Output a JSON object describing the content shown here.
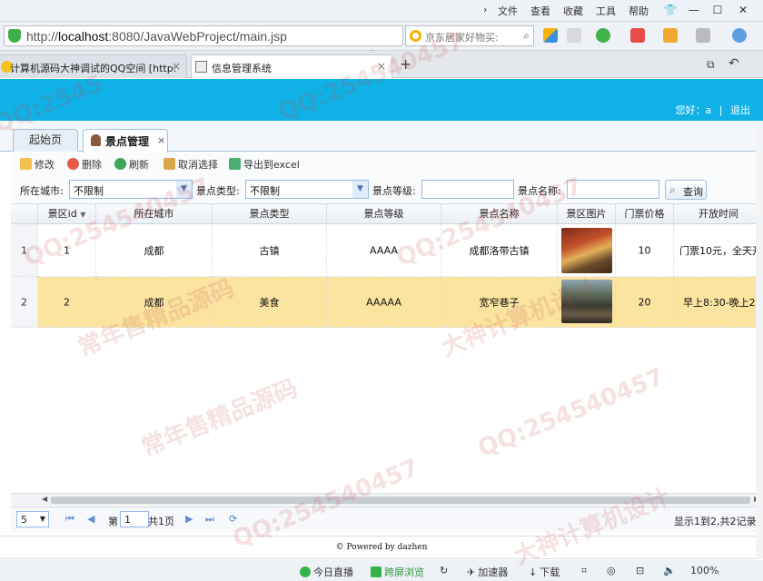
{
  "browser": {
    "menu": [
      "文件",
      "查看",
      "收藏",
      "工具",
      "帮助"
    ],
    "url_prefix": "http://",
    "url_host": "localhost",
    "url_rest": ":8080/JavaWebProject/main.jsp",
    "search_text": "京东居家好物买:",
    "tabs": [
      {
        "label": "计算机源码大神调试的QQ空间 [http:",
        "active": false
      },
      {
        "label": "信息管理系统",
        "active": true
      }
    ],
    "new_tab": "+"
  },
  "app": {
    "user_text": "您好：a",
    "logout_text": "退出",
    "tabs": [
      {
        "label": "起始页",
        "active": false
      },
      {
        "label": "景点管理",
        "active": true
      }
    ],
    "tab_close": "×",
    "toolbar": {
      "edit": "修改",
      "delete": "删除",
      "refresh": "刷新",
      "cancel_select": "取消选择",
      "export": "导出到excel"
    },
    "filters": {
      "city_label": "所在城市:",
      "city_value": "不限制",
      "type_label": "景点类型:",
      "type_value": "不限制",
      "level_label": "景点等级:",
      "level_value": "",
      "name_label": "景点名称:",
      "name_value": "",
      "query_button": "查询"
    },
    "grid": {
      "columns": [
        "景区id",
        "所在城市",
        "景点类型",
        "景点等级",
        "景点名称",
        "景区图片",
        "门票价格",
        "开放时间"
      ],
      "rows": [
        {
          "num": "1",
          "id": "1",
          "city": "成都",
          "type": "古镇",
          "level": "AAAA",
          "name": "成都洛带古镇",
          "price": "10",
          "hours": "门票10元，全天开",
          "selected": false
        },
        {
          "num": "2",
          "id": "2",
          "city": "成都",
          "type": "美食",
          "level": "AAAAA",
          "name": "宽窄巷子",
          "price": "20",
          "hours": "早上8:30-晚上2",
          "selected": true
        }
      ]
    },
    "pager": {
      "page_size": "5",
      "page_label_before": "第",
      "page_value": "1",
      "page_label_after": "共1页",
      "summary": "显示1到2,共2记录"
    },
    "footer": "© Powered by dazhen"
  },
  "statusbar": {
    "items": [
      "今日直播",
      "跨屏浏览",
      "加速器",
      "下载",
      "100%"
    ]
  },
  "watermark": {
    "qq": "QQ:254540457",
    "slogan1": "常年售精品源码",
    "slogan2": "大神计算机设计"
  },
  "colors": {
    "header": "#0fb1e6",
    "selected_row": "#fbe3a0"
  }
}
